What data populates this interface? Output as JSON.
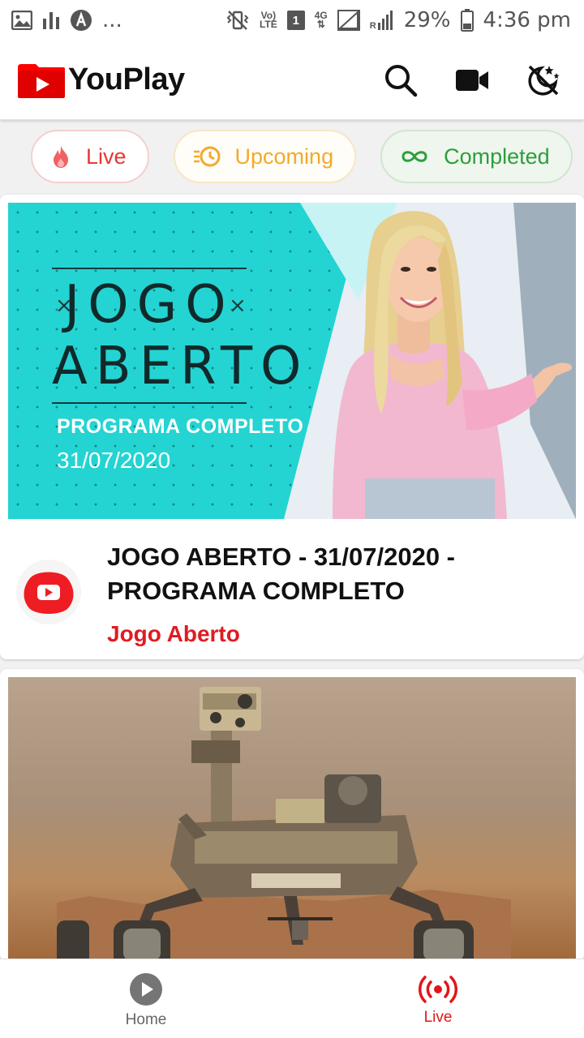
{
  "status_bar": {
    "dots": "...",
    "volte": "Vo)",
    "lte": "LTE",
    "sim_slot": "1",
    "network": "4G",
    "roaming": "R",
    "battery": "29%",
    "time": "4:36 pm"
  },
  "app": {
    "name": "YouPlay",
    "brand_color": "#ff0000"
  },
  "filters": [
    {
      "label": "Live",
      "icon": "fire-icon",
      "color": "#e53935"
    },
    {
      "label": "Upcoming",
      "icon": "history-icon",
      "color": "#f4a92b"
    },
    {
      "label": "Completed",
      "icon": "infinity-icon",
      "color": "#2e9e3a"
    }
  ],
  "videos": [
    {
      "title": "JOGO ABERTO - 31/07/2020 - PROGRAMA COMPLETO",
      "channel": "Jogo Aberto",
      "thumbnail": {
        "title_line1": "JOGO",
        "title_line2": "ABERTO",
        "subtitle": "PROGRAMA COMPLETO",
        "date": "31/07/2020"
      }
    },
    {
      "title": "",
      "channel": "",
      "thumbnail": {
        "subject": "mars-rover-image"
      }
    }
  ],
  "bottom_nav": [
    {
      "label": "Home",
      "icon": "play-circle-icon",
      "active": false
    },
    {
      "label": "Live",
      "icon": "live-broadcast-icon",
      "active": true
    }
  ]
}
